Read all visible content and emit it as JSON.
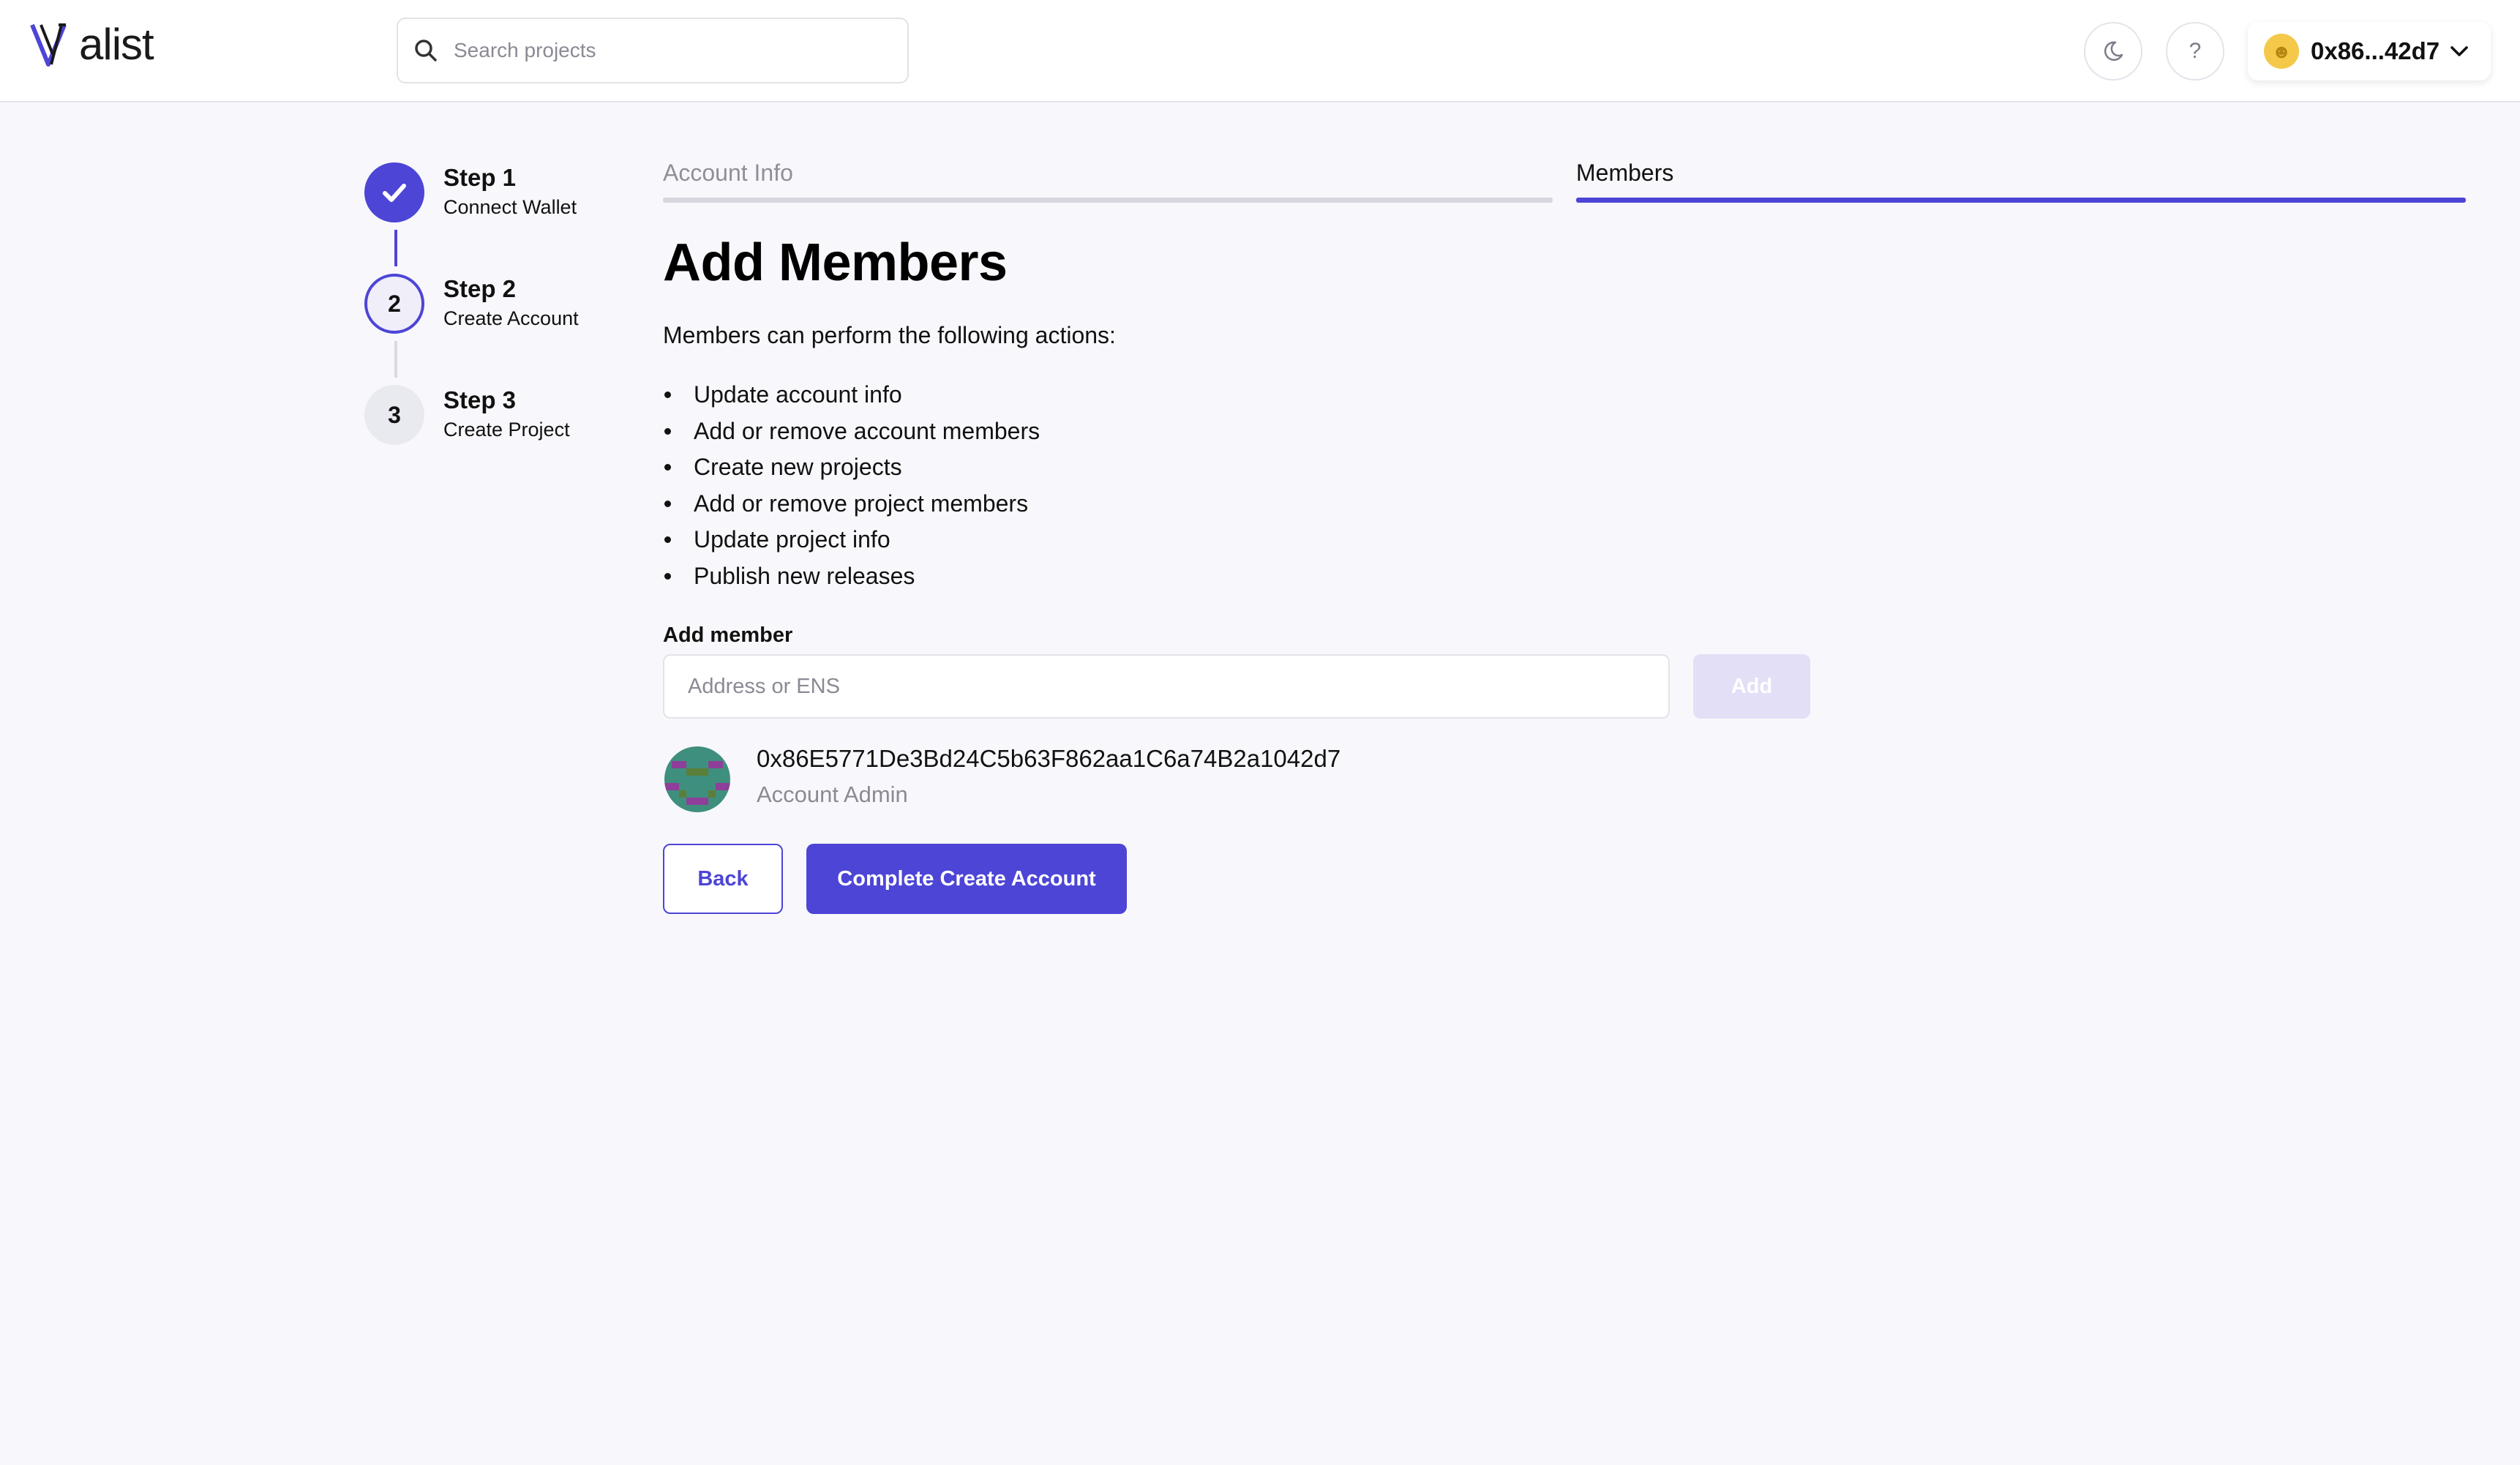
{
  "app": {
    "logo_text": "alist"
  },
  "header": {
    "search_placeholder": "Search projects",
    "help_label": "?",
    "wallet_address": "0x86...42d7"
  },
  "stepper": {
    "steps": [
      {
        "title": "Step 1",
        "subtitle": "Connect Wallet",
        "status": "complete"
      },
      {
        "title": "Step 2",
        "subtitle": "Create Account",
        "number": "2",
        "status": "active"
      },
      {
        "title": "Step 3",
        "subtitle": "Create Project",
        "number": "3",
        "status": "pending"
      }
    ]
  },
  "tabs": [
    {
      "label": "Account Info",
      "active": false
    },
    {
      "label": "Members",
      "active": true
    }
  ],
  "main": {
    "title": "Add Members",
    "intro": "Members can perform the following actions:",
    "actions": [
      "Update account info",
      "Add or remove account members",
      "Create new projects",
      "Add or remove project members",
      "Update project info",
      "Publish new releases"
    ],
    "add_member_label": "Add member",
    "add_member_placeholder": "Address or ENS",
    "add_button": "Add",
    "members": [
      {
        "address": "0x86E5771De3Bd24C5b63F862aa1C6a74B2a1042d7",
        "role": "Account Admin"
      }
    ],
    "back_button": "Back",
    "complete_button": "Complete Create Account"
  },
  "colors": {
    "accent": "#4d45d6",
    "background": "#f8f8fc",
    "muted_text": "#8a8a95",
    "disabled_button": "#e2dff7"
  },
  "icons": {
    "search": "search-icon",
    "theme_toggle": "moon-icon",
    "help": "help-icon",
    "wallet_dropdown": "chevron-down-icon",
    "step_complete": "check-icon"
  }
}
